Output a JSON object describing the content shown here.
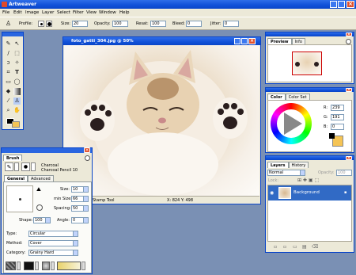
{
  "app": {
    "title": "Artweaver"
  },
  "menu": [
    "File",
    "Edit",
    "Image",
    "Layer",
    "Select",
    "Filter",
    "View",
    "Window",
    "Help"
  ],
  "options": {
    "profile_label": "Profile:",
    "size_label": "Size:",
    "size_value": "20",
    "opacity_label": "Opacity:",
    "opacity_value": "100",
    "resat_label": "Resat:",
    "resat_value": "100",
    "bleed_label": "Bleed:",
    "bleed_value": "0",
    "jitter_label": "Jitter:",
    "jitter_value": "0"
  },
  "doc": {
    "title": "foto_gatti_304.jpg @ 50%",
    "status_tool": "Stamp Tool",
    "status_coords": "X: 824  Y: 498"
  },
  "preview": {
    "tab1": "Preview",
    "tab2": "Info"
  },
  "color": {
    "tab1": "Color",
    "tab2": "Color Set",
    "r_label": "R:",
    "r_value": "239",
    "g_label": "G:",
    "g_value": "191",
    "b_label": "B:",
    "b_value": "0",
    "accent": "#f5c455"
  },
  "layers": {
    "tab1": "Layers",
    "tab2": "History",
    "mode": "Normal",
    "opacity_label": "Opacity:",
    "opacity_value": "100",
    "lock_label": "Lock:",
    "layer_name": "Background"
  },
  "brush": {
    "title": "Brush",
    "category_name": "Charcoal",
    "variant_name": "Charcoal Pencil 10",
    "tab_general": "General",
    "tab_advanced": "Advanced",
    "size_label": "Size:",
    "size_value": "10",
    "minsize_label": "min Size:",
    "minsize_value": "66",
    "spacing_label": "Spacing:",
    "spacing_value": "50",
    "shape_label": "Shape:",
    "shape_value": "100",
    "angle_label": "Angle:",
    "angle_value": "0",
    "type_label": "Type:",
    "type_value": "Circular",
    "method_label": "Method:",
    "method_value": "Cover",
    "cat_label": "Category:",
    "cat_value": "Grainy Hard"
  }
}
